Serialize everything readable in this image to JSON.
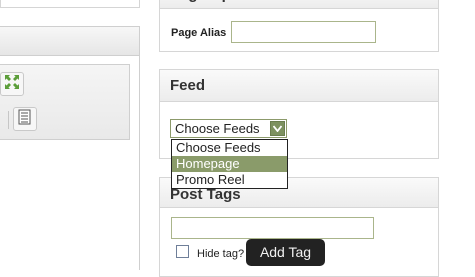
{
  "page_options": {
    "title": "Page Options",
    "alias_label": "Page Alias",
    "alias_value": ""
  },
  "feed": {
    "title": "Feed",
    "select_value": "Choose Feeds",
    "options": [
      "Choose Feeds",
      "Homepage",
      "Promo Reel"
    ],
    "highlighted_option": "Homepage"
  },
  "post_tags": {
    "title": "Post Tags",
    "tag_input_value": "",
    "hide_tag_label": "Hide tag?",
    "add_tag_tooltip": "Add Tag"
  },
  "icons": {
    "expand": "expand-arrows-icon",
    "document": "document-icon"
  },
  "colors": {
    "accent_green": "#8a9b6a",
    "input_border": "#aab58b"
  }
}
